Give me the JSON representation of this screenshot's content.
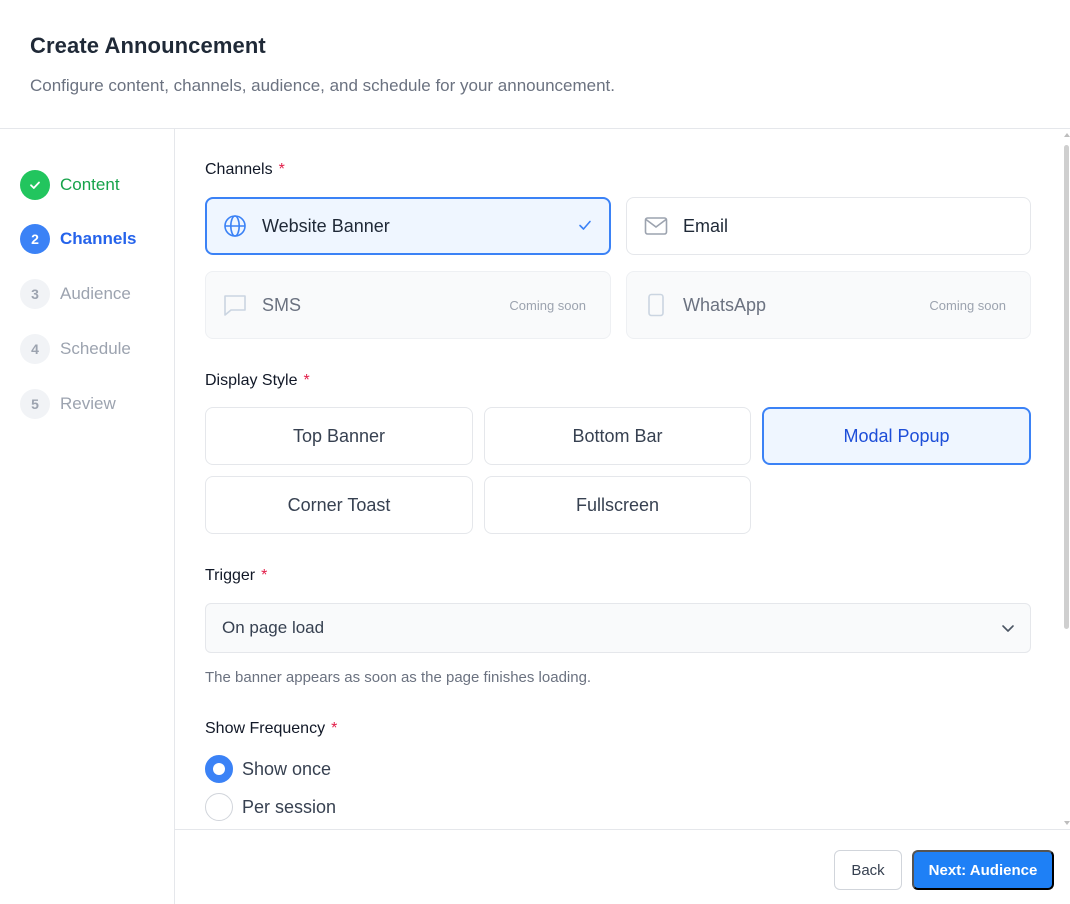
{
  "header": {
    "title": "Create Announcement",
    "subtitle": "Configure content, channels, audience, and schedule for your announcement."
  },
  "steps": [
    {
      "number": "",
      "label": "Content",
      "state": "done"
    },
    {
      "number": "2",
      "label": "Channels",
      "state": "active"
    },
    {
      "number": "3",
      "label": "Audience",
      "state": "todo"
    },
    {
      "number": "4",
      "label": "Schedule",
      "state": "todo"
    },
    {
      "number": "5",
      "label": "Review",
      "state": "todo"
    }
  ],
  "channels": {
    "label": "Channels",
    "required": "*",
    "options": [
      {
        "label": "Website Banner",
        "icon": "globe-icon",
        "selected": true
      },
      {
        "label": "Email",
        "icon": "mail-icon",
        "selected": false
      },
      {
        "label": "SMS",
        "icon": "message-icon",
        "badge": "Coming soon",
        "disabled": true
      },
      {
        "label": "WhatsApp",
        "icon": "phone-icon",
        "badge": "Coming soon",
        "disabled": true
      }
    ]
  },
  "display_style": {
    "label": "Display Style",
    "required": "*",
    "options": [
      "Top Banner",
      "Bottom Bar",
      "Modal Popup",
      "Corner Toast",
      "Fullscreen"
    ],
    "selected": "Modal Popup"
  },
  "trigger": {
    "label": "Trigger",
    "required": "*",
    "value": "On page load",
    "hint": "The banner appears as soon as the page finishes loading."
  },
  "frequency": {
    "label": "Show Frequency",
    "required": "*",
    "options": [
      "Show once",
      "Per session"
    ],
    "selected": "Show once"
  },
  "footer": {
    "back_label": "Back",
    "next_label": "Next: Audience"
  },
  "colors": {
    "accent": "#3b82f6",
    "success": "#22c55e",
    "primary_button": "#1e80f6",
    "required": "#e11d48"
  }
}
